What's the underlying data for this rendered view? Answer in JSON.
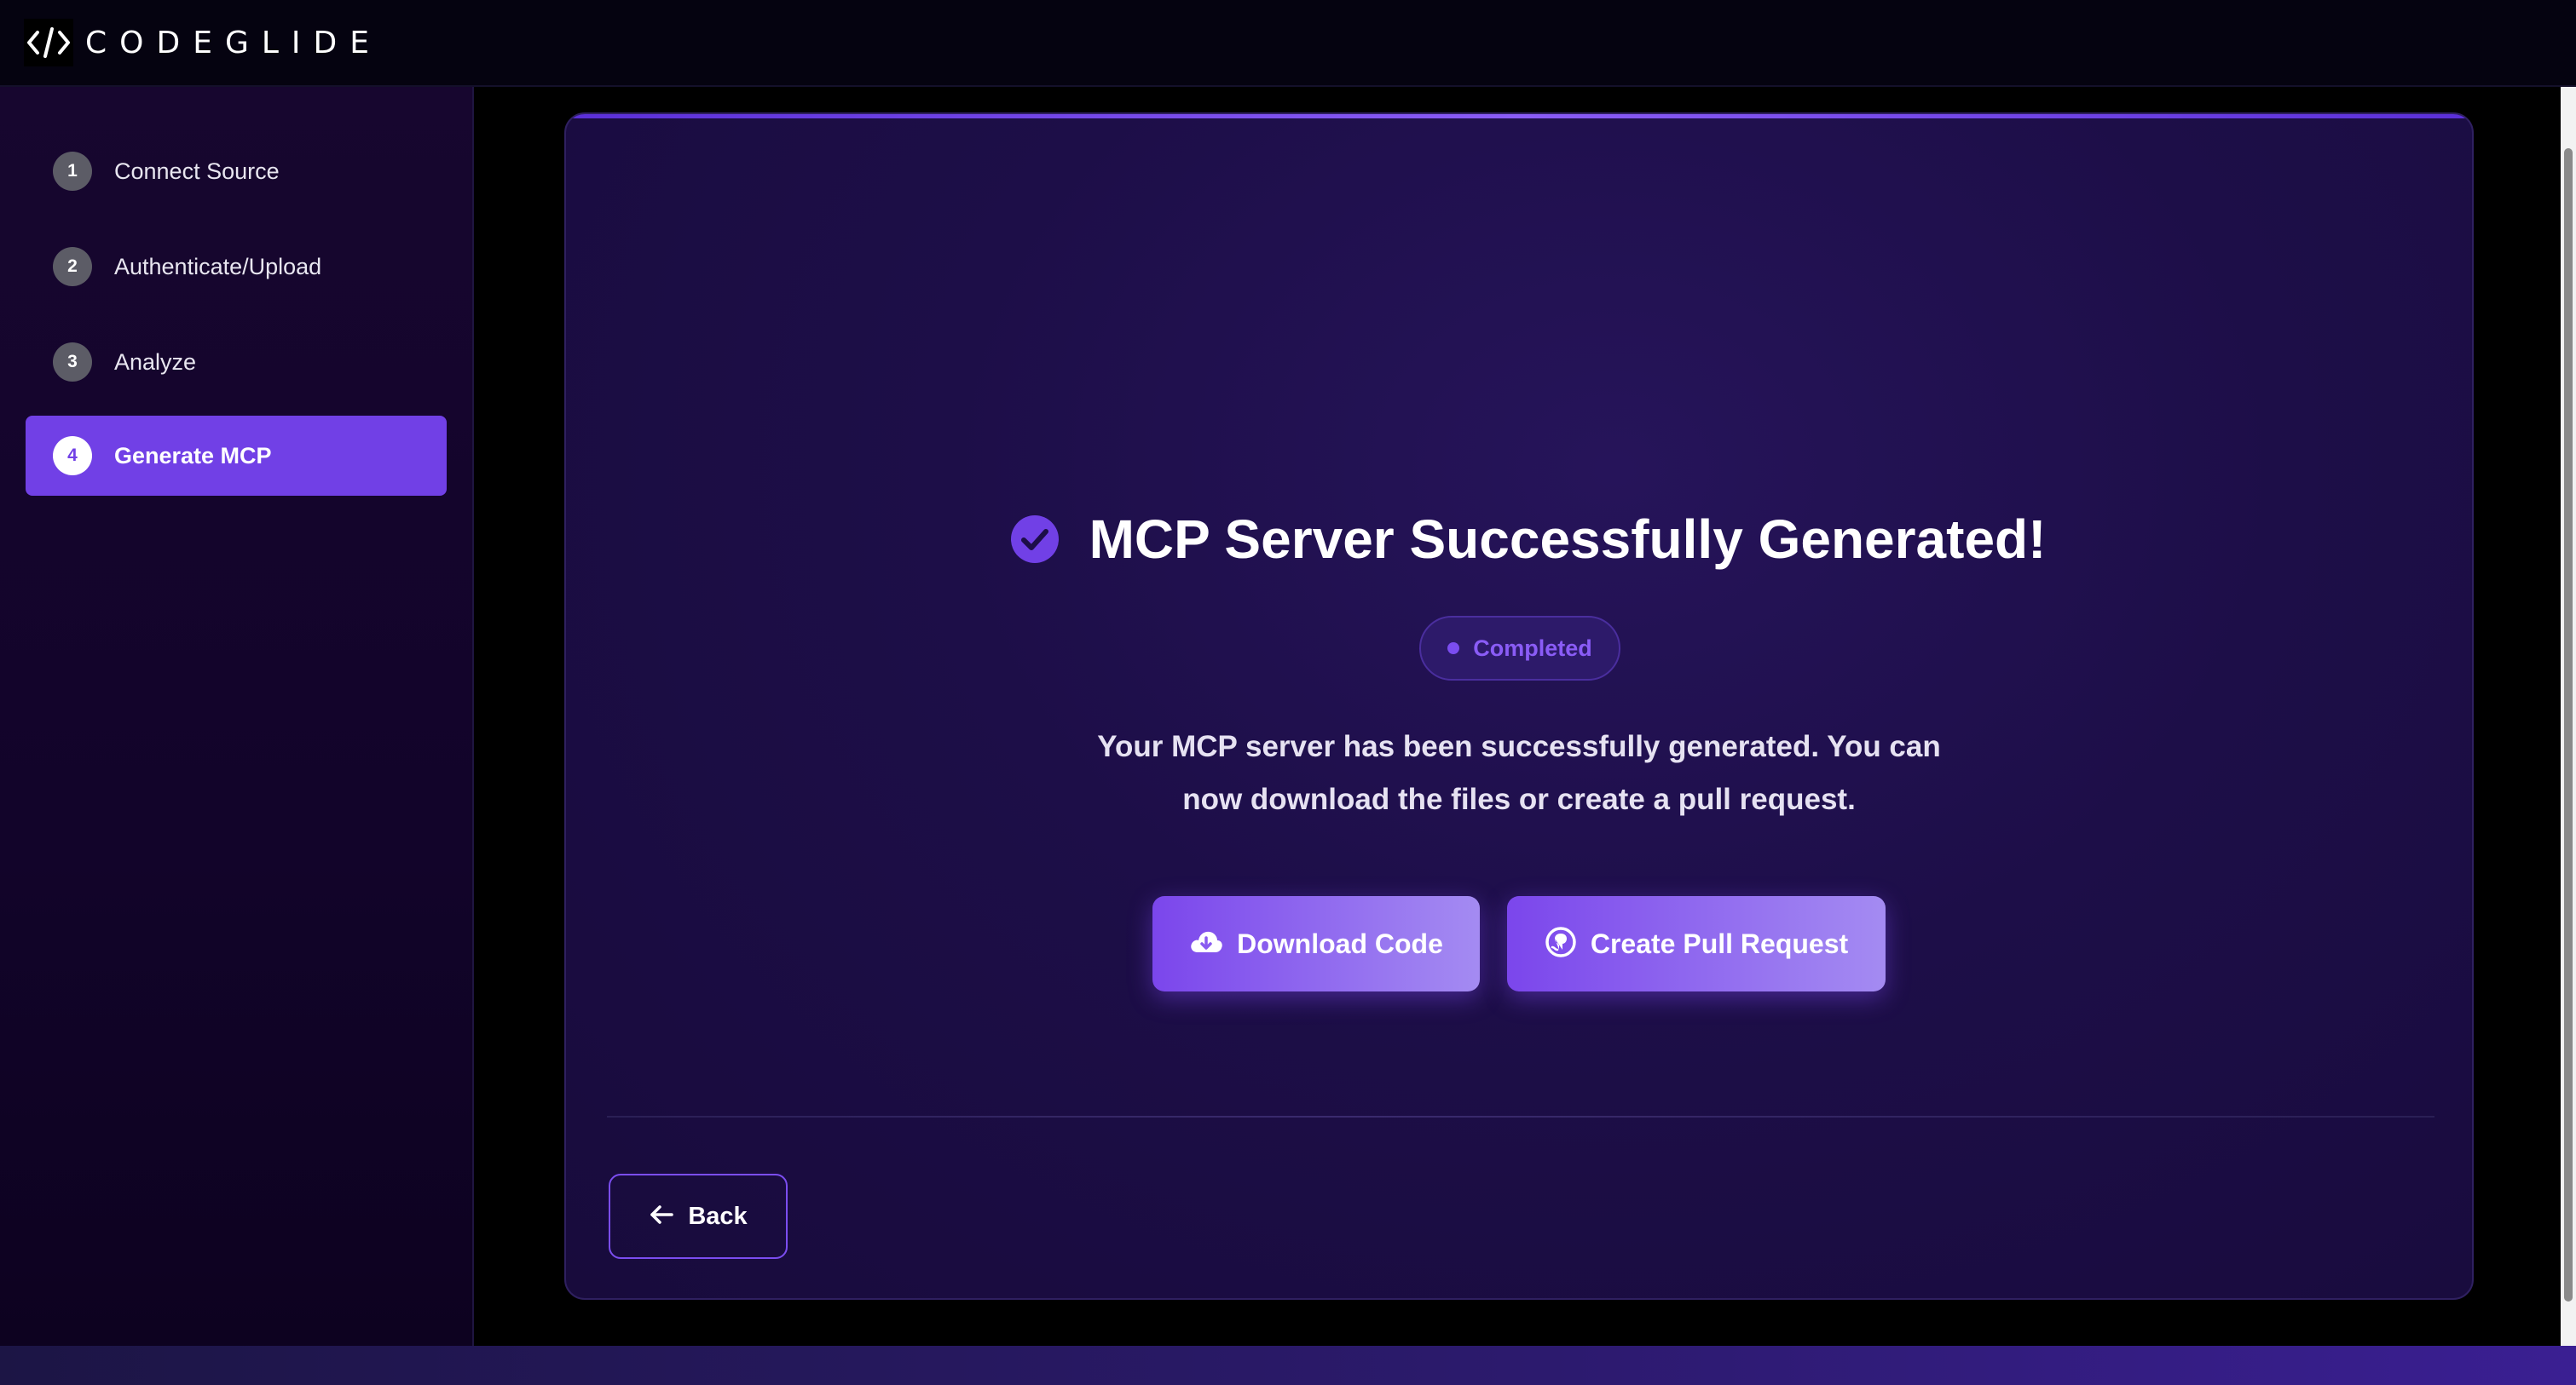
{
  "header": {
    "logo_icon": "code-brackets-icon",
    "logo_text": "CODEGLIDE"
  },
  "sidebar": {
    "steps": [
      {
        "number": "1",
        "label": "Connect Source",
        "active": false
      },
      {
        "number": "2",
        "label": "Authenticate/Upload",
        "active": false
      },
      {
        "number": "3",
        "label": "Analyze",
        "active": false
      },
      {
        "number": "4",
        "label": "Generate MCP",
        "active": true
      }
    ]
  },
  "main": {
    "title_icon": "check-circle-icon",
    "title": "MCP Server Successfully Generated!",
    "status_badge": "Completed",
    "description": "Your MCP server has been successfully generated. You can now download the files or create a pull request.",
    "buttons": {
      "download_label": "Download Code",
      "download_icon": "cloud-download-icon",
      "pull_request_label": "Create Pull Request",
      "pull_request_icon": "github-icon"
    },
    "back_label": "Back",
    "back_icon": "arrow-left-icon"
  },
  "colors": {
    "accent": "#7140e6",
    "accent_light": "#a48bf2",
    "card_background": "#1d0e48",
    "sidebar_background": "#17062f",
    "badge_text": "#8a5cf6"
  }
}
